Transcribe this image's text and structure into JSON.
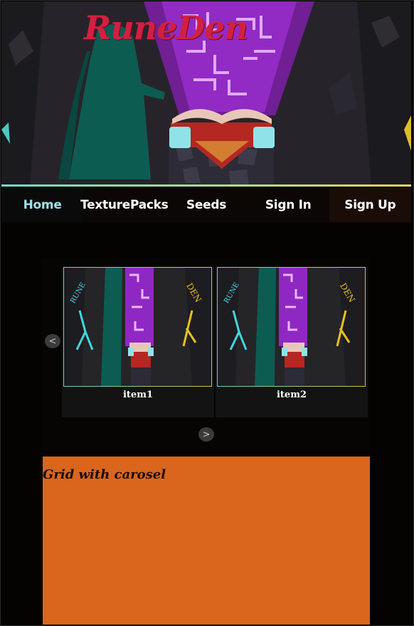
{
  "brand": {
    "name": "RuneDen"
  },
  "nav": {
    "items": [
      {
        "label": "Home",
        "active": true
      },
      {
        "label": "TexturePacks",
        "active": false
      },
      {
        "label": "Seeds",
        "active": false
      },
      {
        "label": "Sign In",
        "active": false
      },
      {
        "label": "Sign Up",
        "active": false
      }
    ]
  },
  "carousel": {
    "prev_label": "<",
    "next_label": ">",
    "items": [
      {
        "label": "item1",
        "rune_left": "RUNE",
        "rune_right": "DEN"
      },
      {
        "label": "item2",
        "rune_left": "RUNE",
        "rune_right": "DEN"
      }
    ]
  },
  "grid": {
    "title": "Grid with carosel"
  },
  "colors": {
    "accent_teal": "#9fe0ea",
    "brand_red": "#d22042",
    "grid_orange": "#d9661c",
    "page_bg": "#050302"
  }
}
